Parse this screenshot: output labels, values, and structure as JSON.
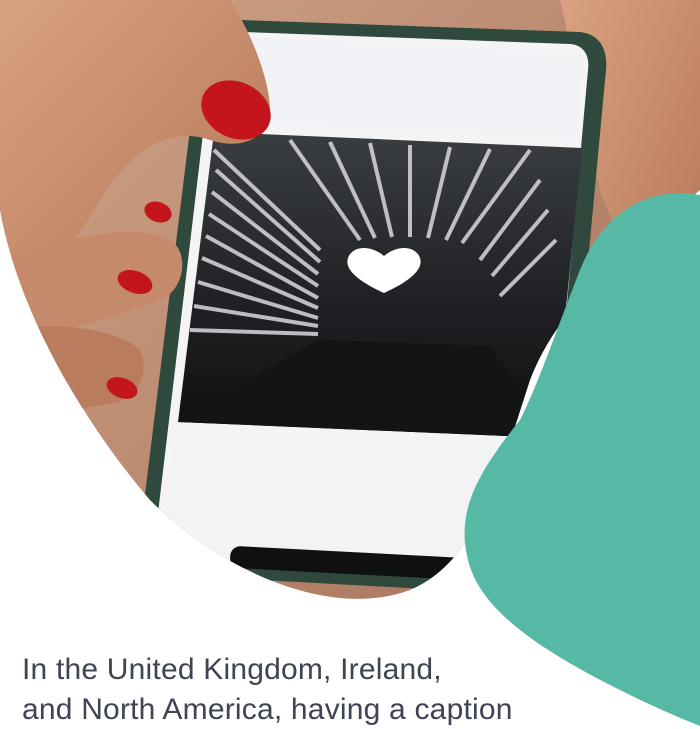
{
  "article": {
    "body_lines": [
      "In the United Kingdom, Ireland,",
      "and North America, having a caption"
    ]
  },
  "image": {
    "description_icon": "heart-icon",
    "subject": "hand-holding-smartphone-photo"
  },
  "colors": {
    "accent_blob": "#56b9a5",
    "text": "#3e4453",
    "nail_polish": "#c4141c",
    "background": "#ffffff"
  }
}
